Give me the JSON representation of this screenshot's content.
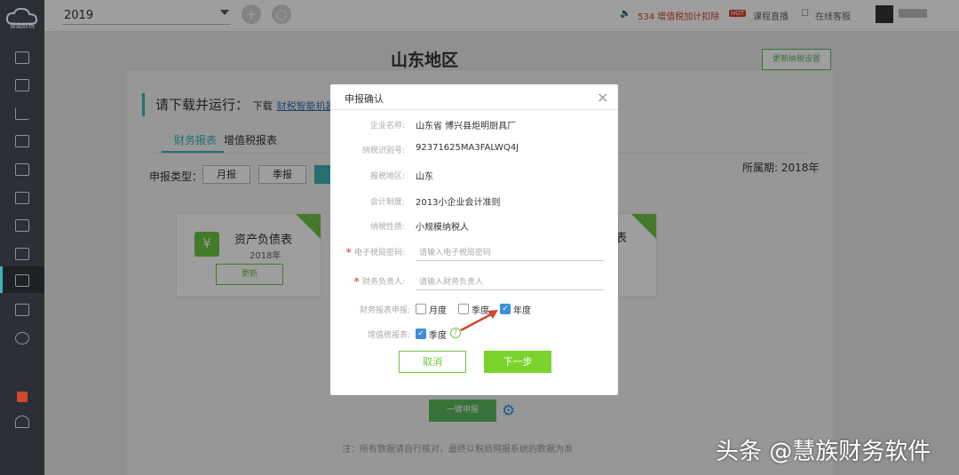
{
  "sidebar": {
    "logo_text": "智能财税"
  },
  "topbar": {
    "year": "2019",
    "items": [
      "534 增值税加计扣除",
      "课程直播",
      "在线客服"
    ],
    "hot_badge": "HOT"
  },
  "main": {
    "region_title": "山东地区",
    "update_button": "更新纳税设置",
    "download_label": "请下载并运行：",
    "download_pre": "下载",
    "download_link": "财税智能机器人",
    "tabs": [
      "财务报表",
      "增值税报表"
    ],
    "type_label": "申报类型：",
    "type_buttons": [
      "月报",
      "季报"
    ],
    "period": "所属期: 2018年",
    "card_title": "资产负债表",
    "card_year": "2018年",
    "card_button": "更新",
    "card2_title": "表",
    "card_icon": "¥",
    "oneclick_button": "一键申报",
    "note": "注：所有数据请自行核对，最终以税局网报系统的数据为准"
  },
  "dialog": {
    "title": "申报确认",
    "close": "×",
    "rows": [
      {
        "label": "企业名称:",
        "value": "山东省 博兴县炬明厨具厂"
      },
      {
        "label": "纳税识别号:",
        "value": "92371625MA3FALWQ4J"
      },
      {
        "label": "报税地区:",
        "value": "山东"
      },
      {
        "label": "会计制度:",
        "value": "2013小企业会计准则"
      },
      {
        "label": "纳税性质:",
        "value": "小规模纳税人"
      }
    ],
    "tax_password": {
      "label": "电子税局密码:",
      "placeholder": "请输入电子税局密码"
    },
    "finance_person": {
      "label": "财务负责人:",
      "placeholder": "请输入财务负责人"
    },
    "finance_report": {
      "label": "财务报表申报:",
      "options": [
        "月度",
        "季度",
        "年度"
      ],
      "checked": [
        false,
        false,
        true
      ]
    },
    "vat_report": {
      "label": "增值税报表:",
      "options": [
        "季度"
      ],
      "checked": [
        true
      ]
    },
    "cancel_button": "取消",
    "next_button": "下一步"
  },
  "watermark": "头条 @慧族财务软件",
  "colors": {
    "accent": "#3bb4b8",
    "green": "#7bd32d",
    "red": "#d2452e",
    "checkbox": "#3b8fd6"
  }
}
